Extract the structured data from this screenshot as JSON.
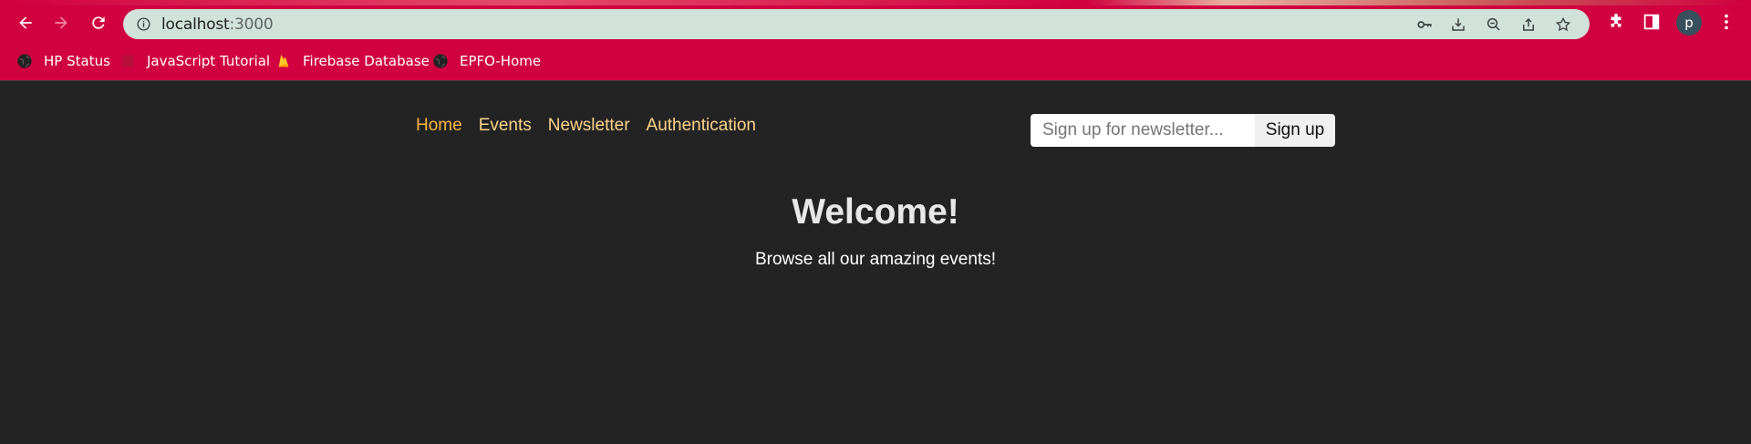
{
  "browser": {
    "url_host": "localhost",
    "url_port": ":3000",
    "avatar_letter": "p",
    "bookmarks": [
      {
        "label": "HP Status",
        "icon": "globe-icon"
      },
      {
        "label": "JavaScript Tutorial",
        "icon": "w3-favicon-icon"
      },
      {
        "label": "Firebase Database",
        "icon": "firebase-icon"
      },
      {
        "label": "EPFO-Home",
        "icon": "globe-icon"
      }
    ],
    "colors": {
      "frame": "#d10040",
      "omnibox": "#d0e2da"
    }
  },
  "nav": {
    "items": [
      {
        "label": "Home",
        "active": true
      },
      {
        "label": "Events",
        "active": false
      },
      {
        "label": "Newsletter",
        "active": false
      },
      {
        "label": "Authentication",
        "active": false
      }
    ]
  },
  "newsletter": {
    "placeholder": "Sign up for newsletter...",
    "button_label": "Sign up"
  },
  "hero": {
    "title": "Welcome!",
    "subtitle": "Browse all our amazing events!"
  },
  "colors": {
    "background": "#232323",
    "nav_link": "#fcd58b",
    "nav_active": "#fcb747"
  }
}
